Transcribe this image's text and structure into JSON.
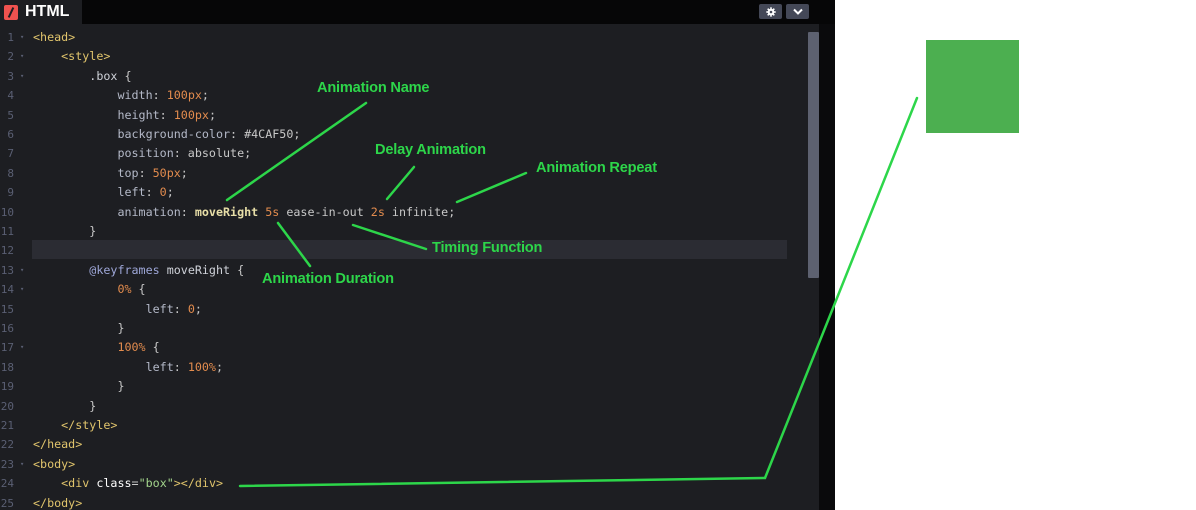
{
  "tab": {
    "title": "HTML"
  },
  "toolbar": {
    "settings_icon": "gear-icon",
    "collapse_icon": "chevron-down-icon"
  },
  "line_numbers": [
    "1",
    "2",
    "3",
    "4",
    "5",
    "6",
    "7",
    "8",
    "9",
    "10",
    "11",
    "12",
    "13",
    "14",
    "15",
    "16",
    "17",
    "18",
    "19",
    "20",
    "21",
    "22",
    "23",
    "24",
    "25"
  ],
  "code_lines": [
    [
      [
        "t",
        "<head>"
      ]
    ],
    [
      [
        "t",
        "    <style>"
      ]
    ],
    [
      [
        "k",
        "        .box "
      ],
      [
        "pl",
        "{"
      ]
    ],
    [
      [
        "p",
        "            width"
      ],
      [
        "pl",
        ": "
      ],
      [
        "n",
        "100px"
      ],
      [
        "pl",
        ";"
      ]
    ],
    [
      [
        "p",
        "            height"
      ],
      [
        "pl",
        ": "
      ],
      [
        "n",
        "100px"
      ],
      [
        "pl",
        ";"
      ]
    ],
    [
      [
        "p",
        "            background-color"
      ],
      [
        "pl",
        ": #4CAF50;"
      ]
    ],
    [
      [
        "p",
        "            position"
      ],
      [
        "pl",
        ": absolute;"
      ]
    ],
    [
      [
        "p",
        "            top"
      ],
      [
        "pl",
        ": "
      ],
      [
        "n",
        "50px"
      ],
      [
        "pl",
        ";"
      ]
    ],
    [
      [
        "p",
        "            left"
      ],
      [
        "pl",
        ": "
      ],
      [
        "n",
        "0"
      ],
      [
        "pl",
        ";"
      ]
    ],
    [
      [
        "p",
        "            animation"
      ],
      [
        "pl",
        ": "
      ],
      [
        "f",
        "moveRight "
      ],
      [
        "n",
        "5s"
      ],
      [
        "pl",
        " ease-in-out "
      ],
      [
        "n",
        "2s"
      ],
      [
        "pl",
        " infinite;"
      ]
    ],
    [
      [
        "pl",
        "        }"
      ]
    ],
    [
      [
        "pl",
        ""
      ]
    ],
    [
      [
        "a",
        "        @keyframes "
      ],
      [
        "k",
        "moveRight "
      ],
      [
        "pl",
        "{"
      ]
    ],
    [
      [
        "n",
        "            0%"
      ],
      [
        "pl",
        " {"
      ]
    ],
    [
      [
        "p",
        "                left"
      ],
      [
        "pl",
        ": "
      ],
      [
        "n",
        "0"
      ],
      [
        "pl",
        ";"
      ]
    ],
    [
      [
        "pl",
        "            }"
      ]
    ],
    [
      [
        "n",
        "            100%"
      ],
      [
        "pl",
        " {"
      ]
    ],
    [
      [
        "p",
        "                left"
      ],
      [
        "pl",
        ": "
      ],
      [
        "n",
        "100%"
      ],
      [
        "pl",
        ";"
      ]
    ],
    [
      [
        "pl",
        "            }"
      ]
    ],
    [
      [
        "pl",
        "        }"
      ]
    ],
    [
      [
        "t",
        "    </style>"
      ]
    ],
    [
      [
        "t",
        "</head>"
      ]
    ],
    [
      [
        "t",
        "<body>"
      ]
    ],
    [
      [
        "t",
        "    <div "
      ],
      [
        "w",
        "class"
      ],
      [
        "pl",
        "="
      ],
      [
        "s",
        "\"box\""
      ],
      [
        "t",
        "></div>"
      ]
    ],
    [
      [
        "t",
        "</body>"
      ]
    ]
  ],
  "fold_markers": [
    "1",
    "2",
    "3",
    "13",
    "14",
    "17",
    "23"
  ],
  "annotations": {
    "animation_name": "Animation Name",
    "delay_animation": "Delay Animation",
    "animation_repeat": "Animation Repeat",
    "timing_function": "Timing Function",
    "animation_duration": "Animation Duration"
  },
  "colors": {
    "editor_bg": "#1d1e22",
    "box": "#4CAF50",
    "annotation": "#2dd64a",
    "tab_icon": "#f0524f"
  }
}
